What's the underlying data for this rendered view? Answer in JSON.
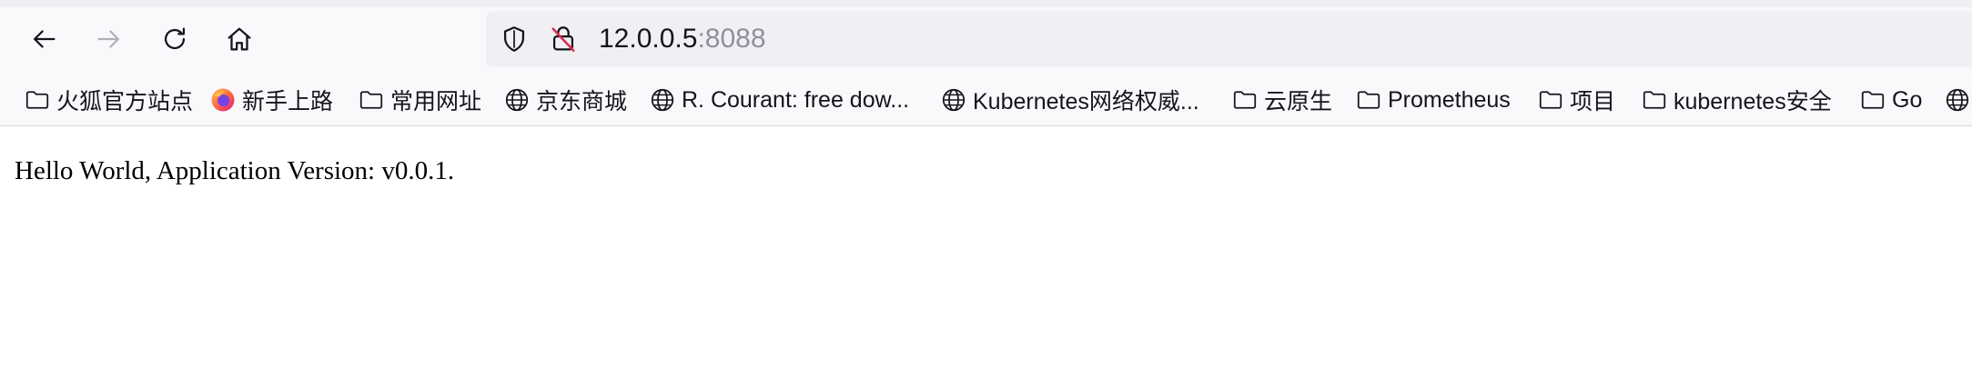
{
  "toolbar": {
    "back_icon": "arrow-left-icon",
    "forward_icon": "arrow-right-icon",
    "reload_icon": "reload-icon",
    "home_icon": "home-icon"
  },
  "urlbar": {
    "host": "12.0.0.5",
    "port": ":8088",
    "shield_icon": "tracking-protection-shield-icon",
    "lock_icon": "insecure-lock-icon"
  },
  "bookmarks": [
    {
      "label": "火狐官方站点",
      "icon": "folder-icon"
    },
    {
      "label": "新手上路",
      "icon": "firefox-logo-icon"
    },
    {
      "label": "常用网址",
      "icon": "folder-icon"
    },
    {
      "label": "京东商城",
      "icon": "globe-icon"
    },
    {
      "label": "R. Courant: free dow...",
      "icon": "globe-icon"
    },
    {
      "label": "Kubernetes网络权威...",
      "icon": "globe-icon"
    },
    {
      "label": "云原生",
      "icon": "folder-icon"
    },
    {
      "label": "Prometheus",
      "icon": "folder-icon"
    },
    {
      "label": "项目",
      "icon": "folder-icon"
    },
    {
      "label": "kubernetes安全",
      "icon": "folder-icon"
    },
    {
      "label": "Go",
      "icon": "folder-icon"
    },
    {
      "label": "",
      "icon": "globe-icon"
    }
  ],
  "page": {
    "text": "Hello World, Application Version: v0.0.1."
  },
  "colors": {
    "toolbar_bg": "#f9f9fb",
    "urlbar_bg": "#f0f0f4",
    "text": "#15141a",
    "port_gray": "#8f8f9d",
    "disabled_icon": "#b0b0b8",
    "lock_slash_red": "#e22850"
  }
}
